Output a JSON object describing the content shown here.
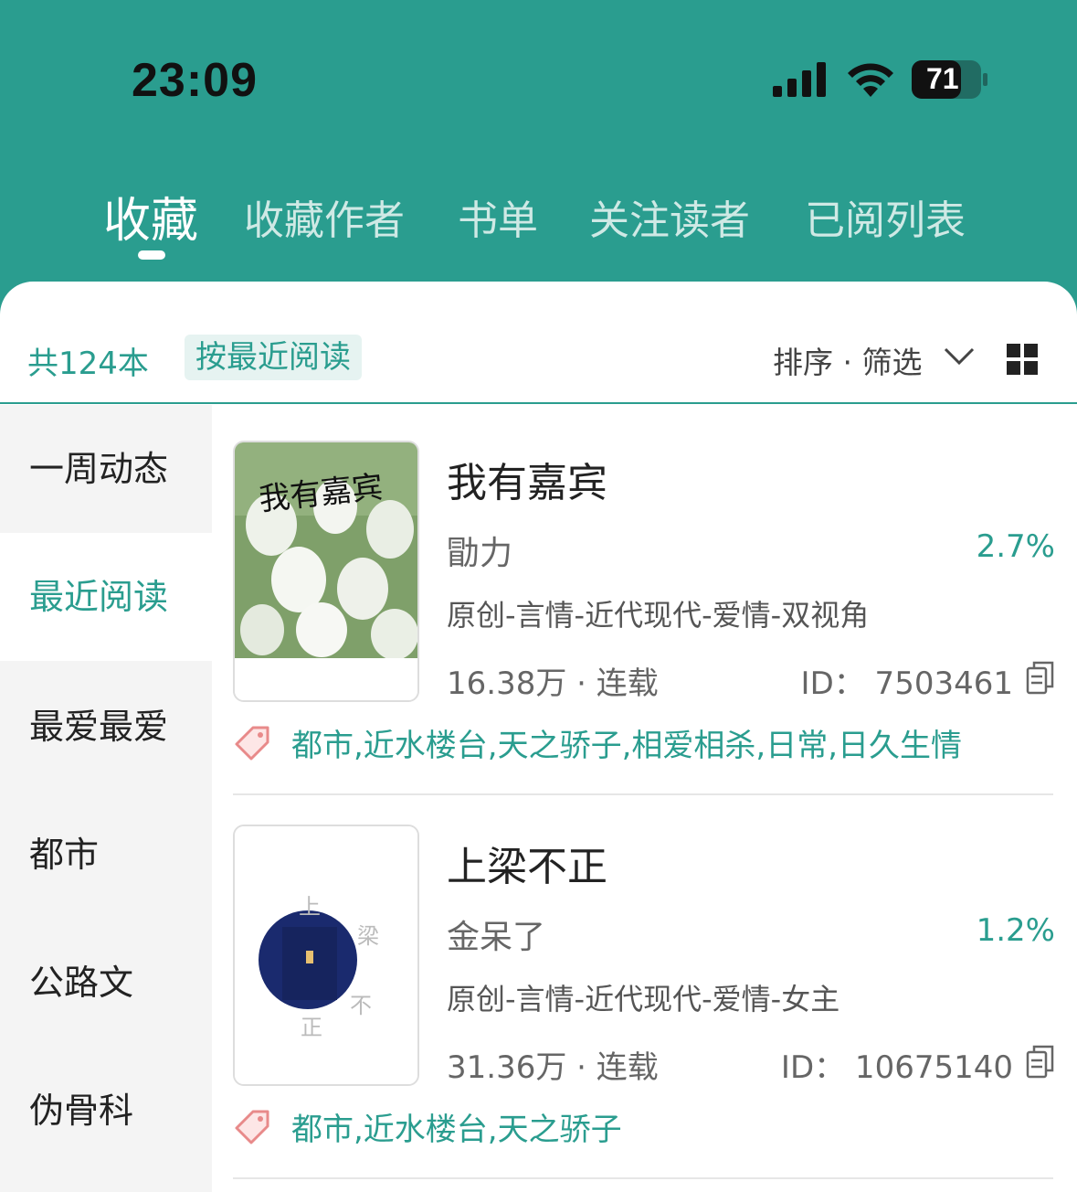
{
  "status_bar": {
    "time": "23:09",
    "battery": "71"
  },
  "tabs": [
    {
      "label": "收藏",
      "active": true
    },
    {
      "label": "收藏作者"
    },
    {
      "label": "书单"
    },
    {
      "label": "关注读者"
    },
    {
      "label": "已阅列表"
    }
  ],
  "toolbar": {
    "count": "共124本",
    "sort_chip": "按最近阅读",
    "filter_label": "排序 · 筛选"
  },
  "sidebar": {
    "items": [
      {
        "label": "一周动态"
      },
      {
        "label": "最近阅读",
        "active": true
      },
      {
        "label": "最爱最爱"
      },
      {
        "label": "都市"
      },
      {
        "label": "公路文"
      },
      {
        "label": "伪骨科"
      }
    ]
  },
  "books": [
    {
      "title": "我有嘉宾",
      "author": "勖力",
      "progress": "2.7%",
      "genre": "原创-言情-近代现代-爱情-双视角",
      "stats": "16.38万 · 连载",
      "id": "ID：  7503461",
      "tags": "都市,近水楼台,天之骄子,相爱相杀,日常,日久生情",
      "cover_text": "我有嘉宾"
    },
    {
      "title": "上梁不正",
      "author": "金呆了",
      "progress": "1.2%",
      "genre": "原创-言情-近代现代-爱情-女主",
      "stats": "31.36万 · 连载",
      "id": "ID：  10675140",
      "tags": "都市,近水楼台,天之骄子",
      "cover_chars": [
        "上",
        "梁",
        "不",
        "正"
      ]
    }
  ],
  "colors": {
    "accent": "#2a9d8f",
    "tag_icon": "#e88a8a"
  }
}
